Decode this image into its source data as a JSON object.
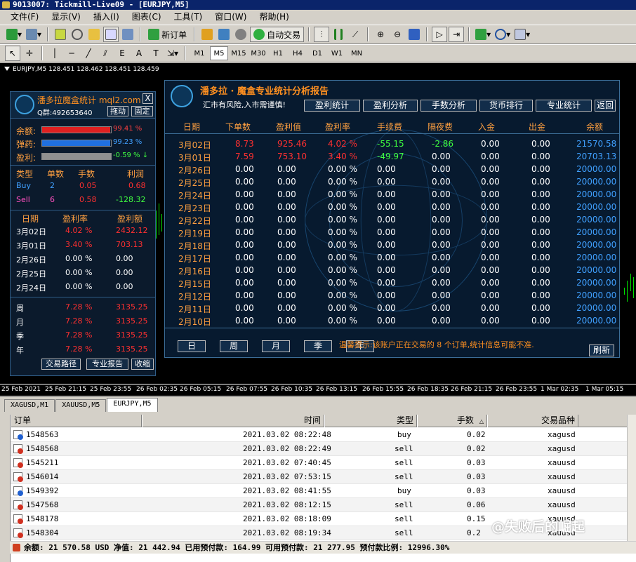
{
  "window": {
    "title": "9013007: Tickmill-Live09 - [EURJPY,M5]"
  },
  "menu": [
    "文件(F)",
    "显示(V)",
    "插入(I)",
    "图表(C)",
    "工具(T)",
    "窗口(W)",
    "帮助(H)"
  ],
  "toolbar": {
    "new_order": "新订单",
    "auto_trading": "自动交易"
  },
  "timeframes": [
    "M1",
    "M5",
    "M15",
    "M30",
    "H1",
    "H4",
    "D1",
    "W1",
    "MN"
  ],
  "active_timeframe": "M5",
  "chart": {
    "header": "EURJPY,M5  128.451 128.462 128.451 128.459",
    "xticks": [
      "25 Feb 2021",
      "25 Feb 21:15",
      "25 Feb 23:55",
      "26 Feb 02:35",
      "26 Feb 05:15",
      "26 Feb 07:55",
      "26 Feb 10:35",
      "26 Feb 13:15",
      "26 Feb 15:55",
      "26 Feb 18:35",
      "26 Feb 21:15",
      "26 Feb 23:55",
      "1 Mar 02:35",
      "1 Mar 05:15"
    ]
  },
  "left_panel": {
    "title": "潘多拉魔盒统计 mql2.com",
    "close": "X",
    "qgroup": "Q群:492653640",
    "drag_btn": "拖动",
    "pin_btn": "固定",
    "balance": {
      "label": "余额:",
      "pct": "99.41 %",
      "fill": 0.99,
      "color": "#e02020"
    },
    "elasticity": {
      "label": "弹药:",
      "pct": "99.23 %",
      "fill": 0.99,
      "color": "#2070e0"
    },
    "profit": {
      "label": "盈利:",
      "pct": "-0.59 % ↓",
      "fill": 1.0,
      "color": "#909090"
    },
    "pos_headers": [
      "类型",
      "单数",
      "手数",
      "利润"
    ],
    "positions": [
      {
        "type": "Buy",
        "count": "2",
        "lots": "0.05",
        "profit": "0.68"
      },
      {
        "type": "Sell",
        "count": "6",
        "lots": "0.58",
        "profit": "-128.32"
      }
    ],
    "day_headers": [
      "日期",
      "盈利率",
      "盈利额"
    ],
    "days": [
      {
        "date": "3月02日",
        "rate": "4.02 %",
        "amt": "2432.12",
        "hl": true
      },
      {
        "date": "3月01日",
        "rate": "3.40 %",
        "amt": "703.13",
        "hl": true
      },
      {
        "date": "2月26日",
        "rate": "0.00 %",
        "amt": "0.00",
        "hl": false
      },
      {
        "date": "2月25日",
        "rate": "0.00 %",
        "amt": "0.00",
        "hl": false
      },
      {
        "date": "2月24日",
        "rate": "0.00 %",
        "amt": "0.00",
        "hl": false
      }
    ],
    "periods": [
      {
        "label": "周",
        "rate": "7.28 %",
        "amt": "3135.25"
      },
      {
        "label": "月",
        "rate": "7.28 %",
        "amt": "3135.25"
      },
      {
        "label": "季",
        "rate": "7.28 %",
        "amt": "3135.25"
      },
      {
        "label": "年",
        "rate": "7.28 %",
        "amt": "3135.25"
      }
    ],
    "footer_btns": [
      "交易路径",
      "专业报告",
      "收缩"
    ]
  },
  "right_panel": {
    "title": "潘多拉 · 魔盒专业统计分析报告",
    "subtitle": "汇市有风险,入市需谨慎!",
    "tabs": [
      "盈利统计",
      "盈利分析",
      "手数分析",
      "货币排行",
      "专业统计",
      "返回"
    ],
    "columns": [
      "日期",
      "下单数",
      "盈利值",
      "盈利率",
      "手续费",
      "隔夜费",
      "入金",
      "出金",
      "余额"
    ],
    "rows": [
      [
        "3月02日",
        "8.73",
        "925.46",
        "4.02 %",
        "-55.15",
        "-2.86",
        "0.00",
        "0.00",
        "21570.58"
      ],
      [
        "3月01日",
        "7.59",
        "753.10",
        "3.40 %",
        "-49.97",
        "0.00",
        "0.00",
        "0.00",
        "20703.13"
      ],
      [
        "2月26日",
        "0.00",
        "0.00",
        "0.00 %",
        "0.00",
        "0.00",
        "0.00",
        "0.00",
        "20000.00"
      ],
      [
        "2月25日",
        "0.00",
        "0.00",
        "0.00 %",
        "0.00",
        "0.00",
        "0.00",
        "0.00",
        "20000.00"
      ],
      [
        "2月24日",
        "0.00",
        "0.00",
        "0.00 %",
        "0.00",
        "0.00",
        "0.00",
        "0.00",
        "20000.00"
      ],
      [
        "2月23日",
        "0.00",
        "0.00",
        "0.00 %",
        "0.00",
        "0.00",
        "0.00",
        "0.00",
        "20000.00"
      ],
      [
        "2月22日",
        "0.00",
        "0.00",
        "0.00 %",
        "0.00",
        "0.00",
        "0.00",
        "0.00",
        "20000.00"
      ],
      [
        "2月19日",
        "0.00",
        "0.00",
        "0.00 %",
        "0.00",
        "0.00",
        "0.00",
        "0.00",
        "20000.00"
      ],
      [
        "2月18日",
        "0.00",
        "0.00",
        "0.00 %",
        "0.00",
        "0.00",
        "0.00",
        "0.00",
        "20000.00"
      ],
      [
        "2月17日",
        "0.00",
        "0.00",
        "0.00 %",
        "0.00",
        "0.00",
        "0.00",
        "0.00",
        "20000.00"
      ],
      [
        "2月16日",
        "0.00",
        "0.00",
        "0.00 %",
        "0.00",
        "0.00",
        "0.00",
        "0.00",
        "20000.00"
      ],
      [
        "2月15日",
        "0.00",
        "0.00",
        "0.00 %",
        "0.00",
        "0.00",
        "0.00",
        "0.00",
        "20000.00"
      ],
      [
        "2月12日",
        "0.00",
        "0.00",
        "0.00 %",
        "0.00",
        "0.00",
        "0.00",
        "0.00",
        "20000.00"
      ],
      [
        "2月11日",
        "0.00",
        "0.00",
        "0.00 %",
        "0.00",
        "0.00",
        "0.00",
        "0.00",
        "20000.00"
      ],
      [
        "2月10日",
        "0.00",
        "0.00",
        "0.00 %",
        "0.00",
        "0.00",
        "0.00",
        "0.00",
        "20000.00"
      ]
    ],
    "period_btns": [
      "日",
      "周",
      "月",
      "季",
      "年"
    ],
    "warning": "温馨提示:该账户正在交易的 8 个订单,统计信息可能不准.",
    "refresh": "刷新"
  },
  "chart_tabs": [
    "XAGUSD,M1",
    "XAUUSD,M5",
    "EURJPY,M5"
  ],
  "active_chart_tab": "EURJPY,M5",
  "terminal": {
    "headers": [
      "订单",
      "时间",
      "类型",
      "手数",
      "交易品种"
    ],
    "rows": [
      {
        "order": "1548563",
        "time": "2021.03.02 08:22:48",
        "type": "buy",
        "lots": "0.02",
        "symbol": "xagusd"
      },
      {
        "order": "1548568",
        "time": "2021.03.02 08:22:49",
        "type": "sell",
        "lots": "0.02",
        "symbol": "xagusd"
      },
      {
        "order": "1545211",
        "time": "2021.03.02 07:40:45",
        "type": "sell",
        "lots": "0.03",
        "symbol": "xauusd"
      },
      {
        "order": "1546014",
        "time": "2021.03.02 07:53:15",
        "type": "sell",
        "lots": "0.03",
        "symbol": "xauusd"
      },
      {
        "order": "1549392",
        "time": "2021.03.02 08:41:55",
        "type": "buy",
        "lots": "0.03",
        "symbol": "xauusd"
      },
      {
        "order": "1547568",
        "time": "2021.03.02 08:12:15",
        "type": "sell",
        "lots": "0.06",
        "symbol": "xauusd"
      },
      {
        "order": "1548178",
        "time": "2021.03.02 08:18:09",
        "type": "sell",
        "lots": "0.15",
        "symbol": "xauusd"
      },
      {
        "order": "1548304",
        "time": "2021.03.02 08:19:34",
        "type": "sell",
        "lots": "0.2",
        "symbol": "xauusd"
      }
    ],
    "status": "余额: 21 570.58 USD  净值: 21 442.94  已用预付款: 164.99  可用预付款: 21 277.95  预付款比例: 12996.30%"
  },
  "watermark": "@失败后的崛起",
  "colors": {
    "orange": "#ffa040",
    "red": "#ff3030",
    "green": "#40ff40",
    "blue": "#40a0ff"
  }
}
